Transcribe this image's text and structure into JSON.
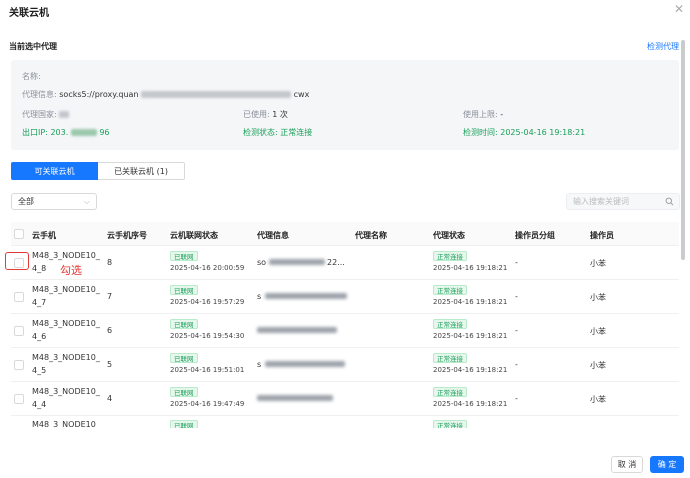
{
  "dialog": {
    "title": "关联云机",
    "close_icon": "close-icon"
  },
  "current_proxy": {
    "section_title": "当前选中代理",
    "detect_link": "检测代理",
    "name_label": "名称:",
    "proxy_info_label": "代理信息:",
    "proxy_info_prefix": "socks5://proxy.quan",
    "proxy_info_suffix": "cwx",
    "country_label": "代理国家:",
    "used_label": "已使用:",
    "used_value": "1 次",
    "limit_label": "使用上限:",
    "limit_value": "-",
    "exit_ip_label": "出口IP:",
    "exit_ip_prefix": "203.",
    "exit_ip_suffix": "96",
    "status_label": "检测状态:",
    "status_value": "正常连接",
    "time_label": "检测时间:",
    "time_value": "2025-04-16 19:18:21"
  },
  "tabs": [
    {
      "label": "可关联云机"
    },
    {
      "label": "已关联云机 (1)"
    }
  ],
  "filter": {
    "selected": "全部"
  },
  "search": {
    "placeholder": "输入搜索关键词"
  },
  "table": {
    "columns": [
      "云手机",
      "云手机序号",
      "云机联网状态",
      "代理信息",
      "代理名称",
      "代理状态",
      "操作员分组",
      "操作员"
    ],
    "rows": [
      {
        "name_line1": "M48_3_NODE10_",
        "name_line2": "4_8",
        "seq": "8",
        "net_tag": "已联网",
        "net_time": "2025-04-16 20:00:59",
        "proxy_prefix": "so",
        "proxy_suffix": "22...",
        "proxy_status": "正常连接",
        "proxy_time": "2025-04-16 19:18:21",
        "group": "-",
        "operator": "小苯"
      },
      {
        "name_line1": "M48_3_NODE10_",
        "name_line2": "4_7",
        "seq": "7",
        "net_tag": "已联网",
        "net_time": "2025-04-16 19:57:29",
        "proxy_prefix": "s",
        "proxy_suffix": "",
        "proxy_status": "正常连接",
        "proxy_time": "2025-04-16 19:18:21",
        "group": "-",
        "operator": "小苯"
      },
      {
        "name_line1": "M48_3_NODE10_",
        "name_line2": "4_6",
        "seq": "6",
        "net_tag": "已联网",
        "net_time": "2025-04-16 19:54:30",
        "proxy_prefix": "",
        "proxy_suffix": "",
        "proxy_status": "正常连接",
        "proxy_time": "2025-04-16 19:18:21",
        "group": "-",
        "operator": "小苯"
      },
      {
        "name_line1": "M48_3_NODE10_",
        "name_line2": "4_5",
        "seq": "5",
        "net_tag": "已联网",
        "net_time": "2025-04-16 19:51:01",
        "proxy_prefix": "s",
        "proxy_suffix": "",
        "proxy_status": "正常连接",
        "proxy_time": "2025-04-16 19:18:21",
        "group": "-",
        "operator": "小苯"
      },
      {
        "name_line1": "M48_3_NODE10_",
        "name_line2": "4_4",
        "seq": "4",
        "net_tag": "已联网",
        "net_time": "2025-04-16 19:47:49",
        "proxy_prefix": "",
        "proxy_suffix": "",
        "proxy_status": "正常连接",
        "proxy_time": "2025-04-16 19:18:21",
        "group": "-",
        "operator": "小苯"
      },
      {
        "name_line1": "M48_3_NODE10",
        "name_line2": "",
        "seq": "",
        "net_tag": "已联网",
        "net_time": "",
        "proxy_prefix": "",
        "proxy_suffix": "",
        "proxy_status": "正常连接",
        "proxy_time": "",
        "group": "",
        "operator": ""
      }
    ]
  },
  "annotation": {
    "text": "勾选"
  },
  "footer": {
    "cancel": "取 消",
    "ok": "确 定"
  }
}
